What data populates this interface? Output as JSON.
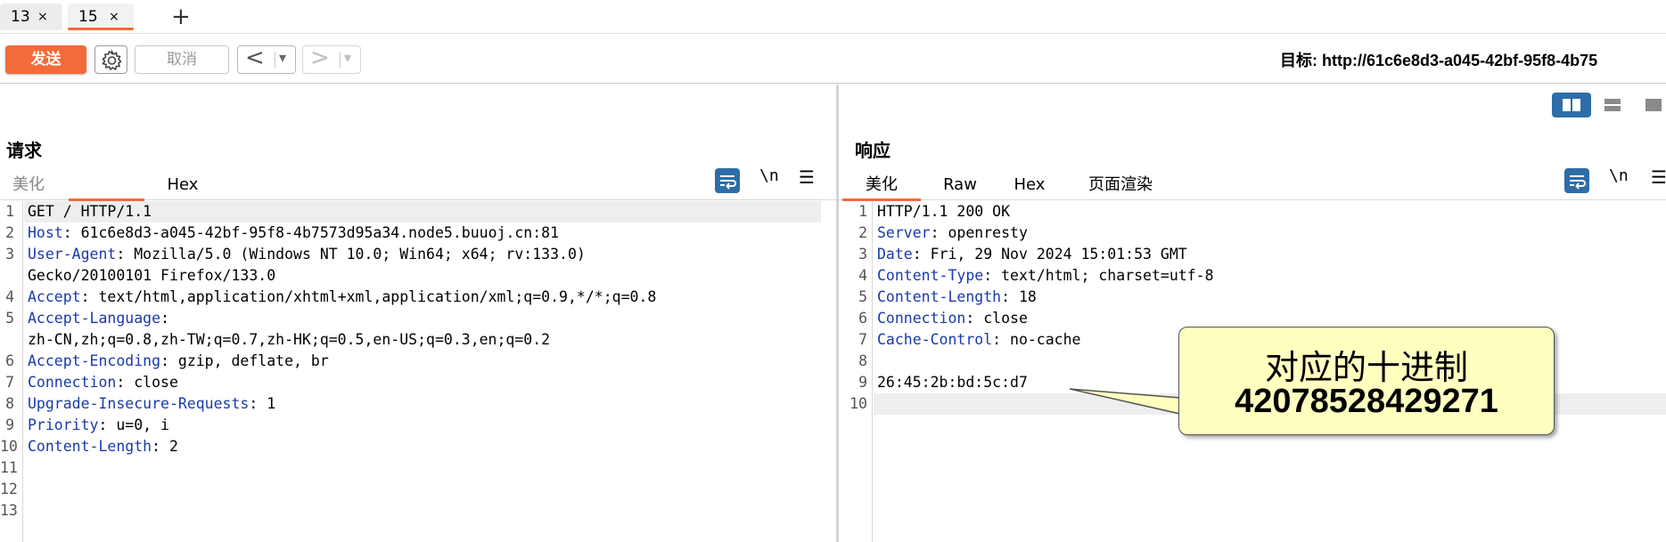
{
  "tabs": [
    {
      "label": "13",
      "close": "×"
    },
    {
      "label": "15",
      "close": "×"
    }
  ],
  "add_tab": "+",
  "toolbar": {
    "send_label": "发送",
    "cancel_label": "取消",
    "back_glyph": "<",
    "forward_glyph": ">",
    "dropdown_glyph": "▾",
    "target": "目标: http://61c6e8d3-a045-42bf-95f8-4b75"
  },
  "request": {
    "title": "请求",
    "tabs": [
      "美化",
      "Hex"
    ],
    "newline_label": "\\n",
    "menu_label": "☰",
    "lines": [
      {
        "n": "1",
        "key": "",
        "rest": "GET / HTTP/1.1"
      },
      {
        "n": "2",
        "key": "Host",
        "rest": ": 61c6e8d3-a045-42bf-95f8-4b7573d95a34.node5.buuoj.cn:81"
      },
      {
        "n": "3",
        "key": "User-Agent",
        "rest": ": Mozilla/5.0 (Windows NT 10.0; Win64; x64; rv:133.0)"
      },
      {
        "n": "",
        "key": "",
        "rest": "Gecko/20100101 Firefox/133.0"
      },
      {
        "n": "4",
        "key": "Accept",
        "rest": ": text/html,application/xhtml+xml,application/xml;q=0.9,*/*;q=0.8"
      },
      {
        "n": "5",
        "key": "Accept-Language",
        "rest": ":"
      },
      {
        "n": "",
        "key": "",
        "rest": "zh-CN,zh;q=0.8,zh-TW;q=0.7,zh-HK;q=0.5,en-US;q=0.3,en;q=0.2"
      },
      {
        "n": "6",
        "key": "Accept-Encoding",
        "rest": ": gzip, deflate, br"
      },
      {
        "n": "7",
        "key": "Connection",
        "rest": ": close"
      },
      {
        "n": "8",
        "key": "Upgrade-Insecure-Requests",
        "rest": ": 1"
      },
      {
        "n": "9",
        "key": "Priority",
        "rest": ": u=0, i"
      },
      {
        "n": "10",
        "key": "Content-Length",
        "rest": ": 2"
      },
      {
        "n": "11",
        "key": "",
        "rest": ""
      },
      {
        "n": "12",
        "key": "",
        "rest": ""
      },
      {
        "n": "13",
        "key": "",
        "rest": ""
      }
    ]
  },
  "response": {
    "title": "响应",
    "tabs": [
      "美化",
      "Raw",
      "Hex",
      "页面渲染"
    ],
    "newline_label": "\\n",
    "menu_label": "☰",
    "lines": [
      {
        "n": "1",
        "key": "",
        "rest": "HTTP/1.1 200 OK"
      },
      {
        "n": "2",
        "key": "Server",
        "rest": ": openresty"
      },
      {
        "n": "3",
        "key": "Date",
        "rest": ": Fri, 29 Nov 2024 15:01:53 GMT"
      },
      {
        "n": "4",
        "key": "Content-Type",
        "rest": ": text/html; charset=utf-8"
      },
      {
        "n": "5",
        "key": "Content-Length",
        "rest": ": 18"
      },
      {
        "n": "6",
        "key": "Connection",
        "rest": ": close"
      },
      {
        "n": "7",
        "key": "Cache-Control",
        "rest": ": no-cache"
      },
      {
        "n": "8",
        "key": "",
        "rest": ""
      },
      {
        "n": "9",
        "key": "",
        "rest": "26:45:2b:bd:5c:d7"
      },
      {
        "n": "10",
        "key": "",
        "rest": ""
      }
    ]
  },
  "callout": {
    "line1": "对应的十进制",
    "line2": "42078528429271"
  },
  "colors": {
    "accent": "#f26b38",
    "header_key": "#1a3aa8",
    "icon_blue": "#2e6da8",
    "callout_bg": "#ffffc0"
  }
}
